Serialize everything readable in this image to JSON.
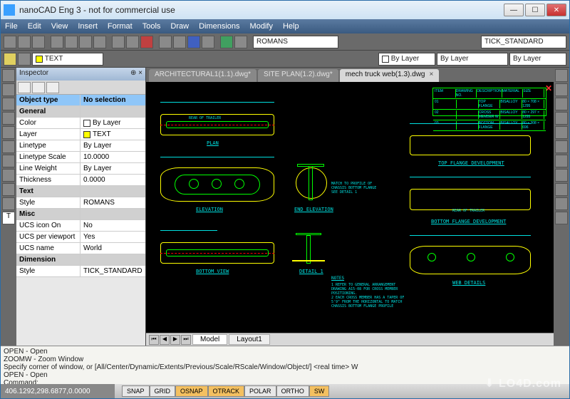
{
  "window": {
    "title": "nanoCAD Eng 3 - not for commercial use"
  },
  "menu": [
    "File",
    "Edit",
    "View",
    "Insert",
    "Format",
    "Tools",
    "Draw",
    "Dimensions",
    "Modify",
    "Help"
  ],
  "toolbar2": {
    "text_combo": "TEXT",
    "font_combo": "ROMANS",
    "style_combo": "TICK_STANDARD",
    "bylayer1": "By Layer",
    "bylayer2": "By Layer",
    "bylayer3": "By Layer"
  },
  "inspector": {
    "title": "Inspector",
    "header_l": "Object type",
    "header_r": "No selection",
    "sections": {
      "general": "General",
      "text": "Text",
      "misc": "Misc",
      "dimension": "Dimension"
    },
    "rows": {
      "color_l": "Color",
      "color_r": "By Layer",
      "layer_l": "Layer",
      "layer_r": "TEXT",
      "linetype_l": "Linetype",
      "linetype_r": "By Layer",
      "ltscale_l": "Linetype Scale",
      "ltscale_r": "10.0000",
      "lineweight_l": "Line Weight",
      "lineweight_r": "By Layer",
      "thickness_l": "Thickness",
      "thickness_r": "0.0000",
      "style_l": "Style",
      "style_r": "ROMANS",
      "ucsicon_l": "UCS icon On",
      "ucsicon_r": "No",
      "ucsvp_l": "UCS per viewport",
      "ucsvp_r": "Yes",
      "ucsname_l": "UCS name",
      "ucsname_r": "World",
      "dimstyle_l": "Style",
      "dimstyle_r": "TICK_STANDARD"
    }
  },
  "doc_tabs": [
    {
      "label": "ARCHITECTURAL1(1.1).dwg*",
      "active": false
    },
    {
      "label": "SITE PLAN(1.2).dwg*",
      "active": false
    },
    {
      "label": "mech truck web(1.3).dwg",
      "active": true
    }
  ],
  "viewport_labels": {
    "plan": "PLAN",
    "elevation": "ELEVATION",
    "end_elev": "END ELEVATION",
    "bottom_view": "BOTTOM VIEW",
    "detail1": "DETAIL 1",
    "top_flange": "TOP FLANGE DEVELOPMENT",
    "bottom_flange": "BOTTOM FLANGE DEVELOPMENT",
    "web_details": "WEB DETAILS",
    "rear_trailer": "REAR OF TRAILER",
    "rear_trailer2": "REAR OF TRAILER",
    "notes_title": "NOTES",
    "note1": "1  REFER TO GENERAL ARRANGEMENT DRAWING A15-08 FOR CROSS MEMBER POSITIONING.",
    "note2": "2  EACH CROSS MEMBER HAS A TAPER OF 5'9\" FROM THE HORIZONTAL TO MATCH CHASSIS BOTTOM FLANGE PROFILE",
    "note3": "MATCH TO PROFILE OF CHASSIS BOTTOM FLANGE SEE DETAIL 1"
  },
  "parts_table": {
    "h1": "ITEM",
    "h2": "DRAWING NO.",
    "h3": "DESCRIPTION",
    "h4": "MATERIAL",
    "h5": "SIZE",
    "r1c3": "TOP FLANGE",
    "r1c4": "BISALLOY",
    "r1c5": "80 × 708 × 1295",
    "r2c3": "CROSS MEMBER W",
    "r2c4": "BISALLOY",
    "r2c5": "80 × 297 × 1295",
    "r3c3": "BOTTOM FLANGE",
    "r3c4": "BISALLOY",
    "r3c5": "80 × 308 × 696"
  },
  "bottom_tabs": {
    "model": "Model",
    "layout1": "Layout1"
  },
  "command": {
    "line1": "OPEN - Open",
    "line2": "ZOOMW - Zoom Window",
    "line3": "Specify corner of window, or [All/Center/Dynamic/Extents/Previous/Scale/RScale/Window/Object/] <real time> W",
    "line4": "OPEN - Open",
    "line5": "Command:"
  },
  "status": {
    "coords": "406.1292,298.6877,0.0000",
    "snap": "SNAP",
    "grid": "GRID",
    "osnap": "OSNAP",
    "otrack": "OTRACK",
    "polar": "POLAR",
    "ortho": "ORTHO",
    "sw": "SW"
  },
  "watermark": "LO4D.com"
}
